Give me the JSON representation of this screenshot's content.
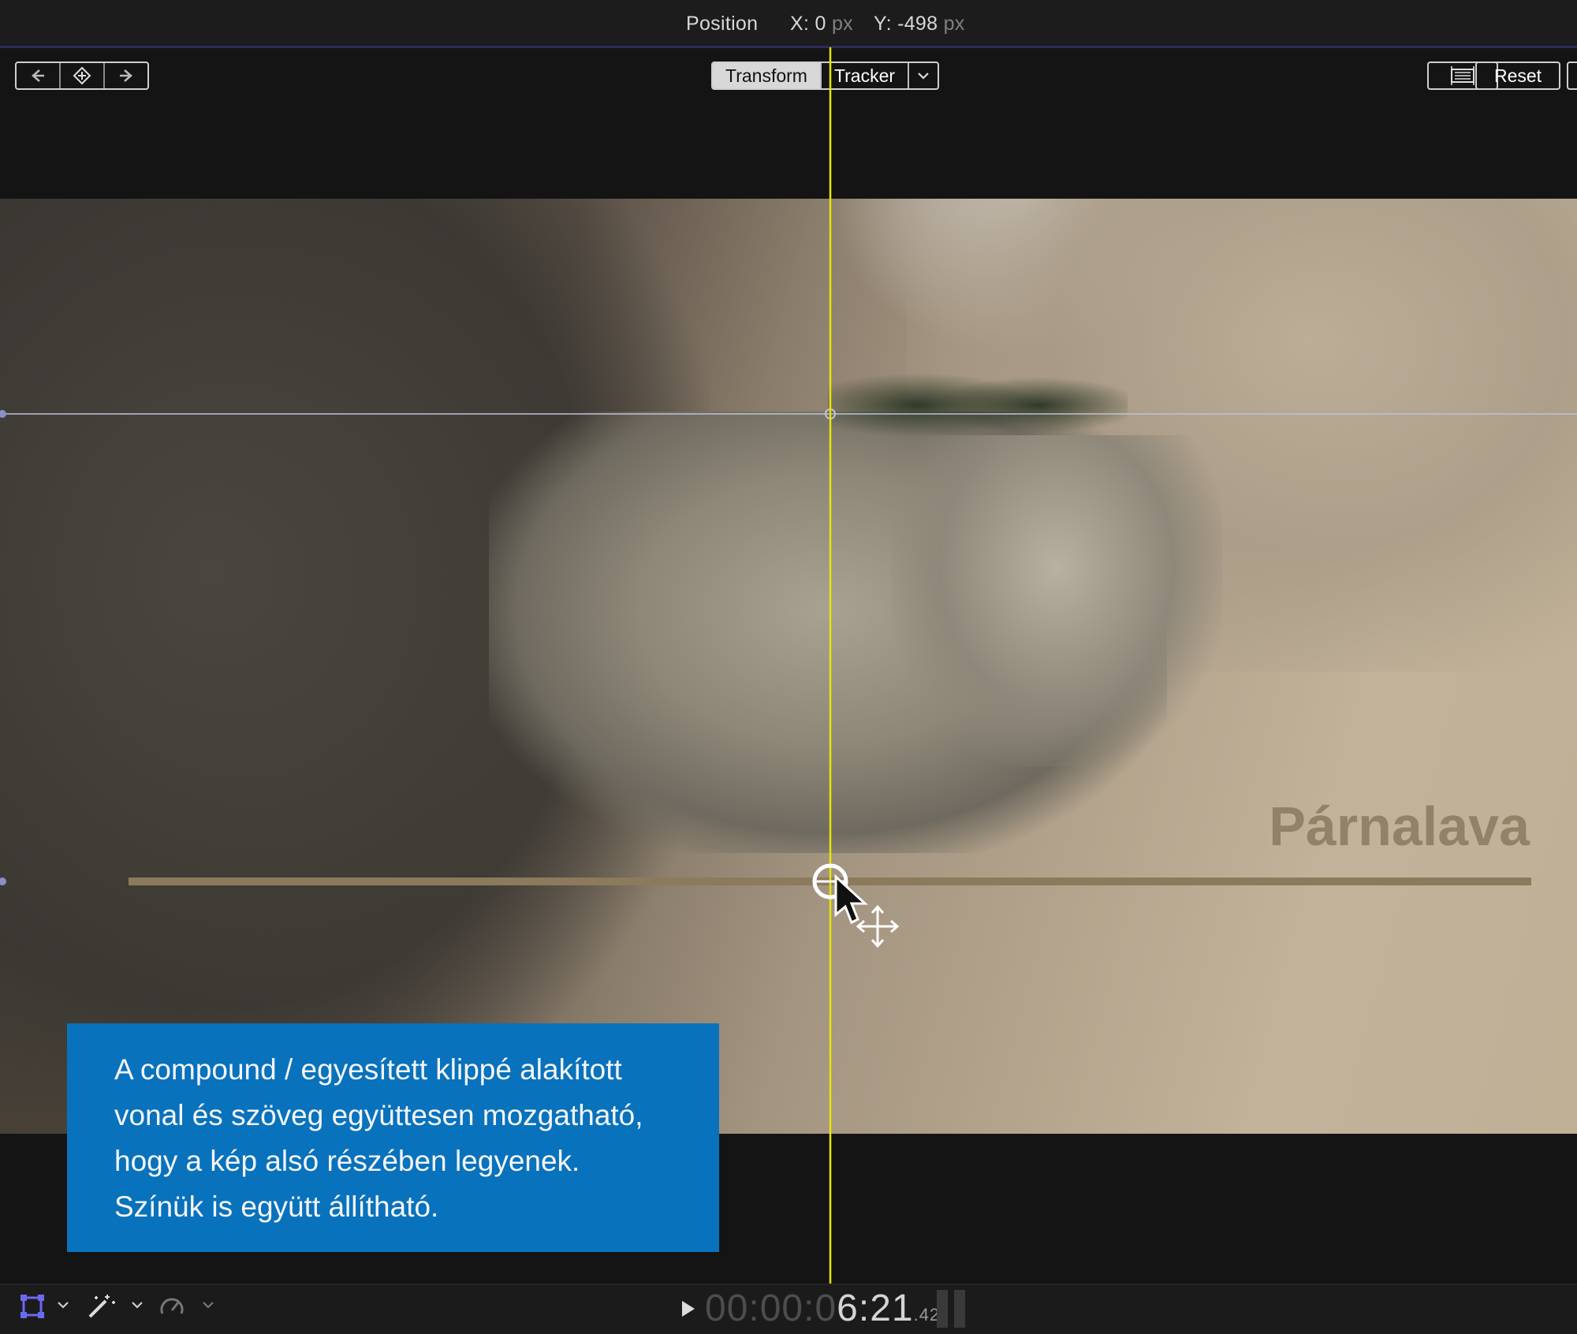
{
  "inspector": {
    "position_label": "Position",
    "x_label": "X:",
    "x_value": "0",
    "y_label": "Y:",
    "y_value": "-498",
    "unit": "px"
  },
  "toolbar": {
    "tab_transform": "Transform",
    "tab_tracker": "Tracker",
    "reset_label": "Reset",
    "keyframe_prev_icon": "arrow-left-icon",
    "keyframe_add_icon": "keyframe-diamond-icon",
    "keyframe_next_icon": "arrow-right-icon",
    "dropdown_icon": "chevron-down-icon",
    "crop_icon": "overlay-guides-icon"
  },
  "viewer": {
    "title_text": "Párnalava",
    "guide_color": "#e6e600",
    "line_color": "#8b7b5c"
  },
  "callout": {
    "text": "A compound / egyesített klippé alakított\nvonal és szöveg együttesen mozgatható,\nhogy a kép alsó részében legyenek.\nSzínük is együtt állítható.",
    "background": "#0872bd"
  },
  "bottombar": {
    "timecode_dim": "00:00:0",
    "timecode_bright": "6:21",
    "timecode_frames": ".42",
    "transform_tool_icon": "transform-tool-icon",
    "enhance_icon": "magic-wand-icon",
    "retime_icon": "speedometer-icon",
    "play_icon": "play-icon"
  }
}
